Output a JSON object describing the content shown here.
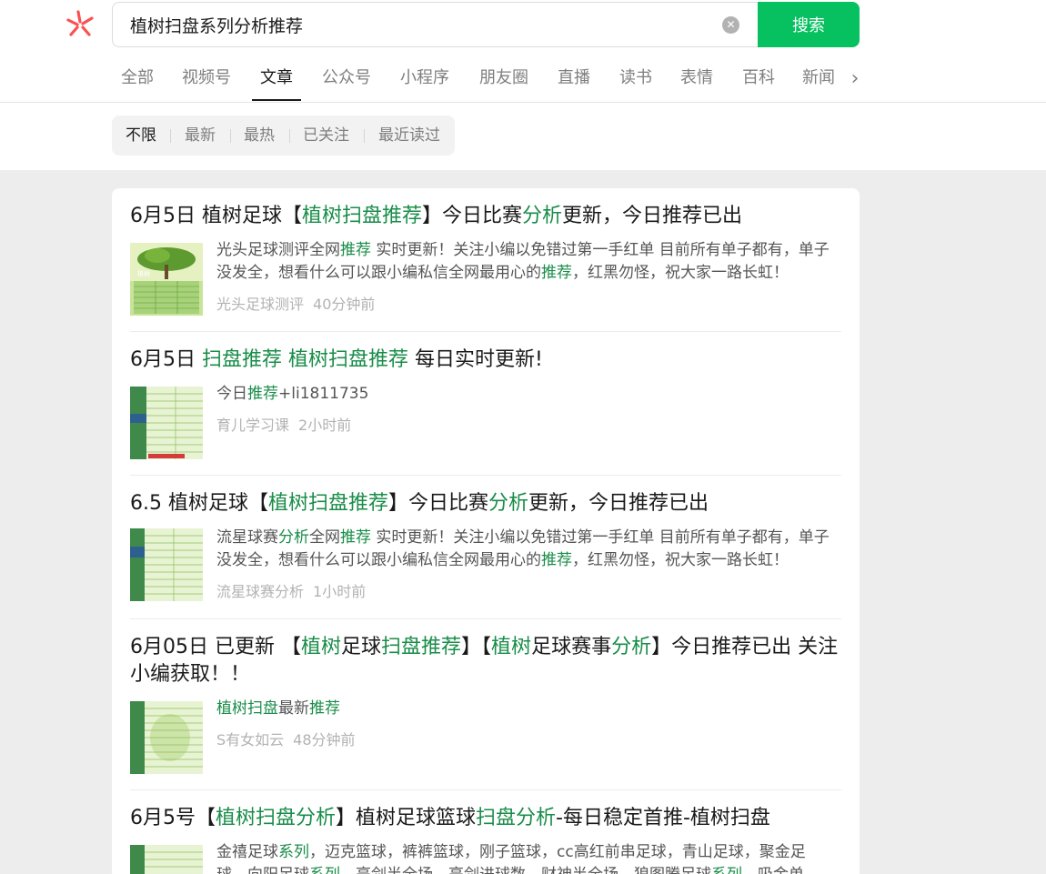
{
  "search": {
    "query": "植树扫盘系列分析推荐",
    "button_label": "搜索",
    "clear_icon": "clear-icon"
  },
  "tabs": [
    {
      "label": "全部"
    },
    {
      "label": "视频号"
    },
    {
      "label": "文章",
      "active": true
    },
    {
      "label": "公众号"
    },
    {
      "label": "小程序"
    },
    {
      "label": "朋友圈"
    },
    {
      "label": "直播"
    },
    {
      "label": "读书"
    },
    {
      "label": "表情"
    },
    {
      "label": "百科"
    },
    {
      "label": "新闻"
    }
  ],
  "filters": [
    {
      "label": "不限",
      "active": true
    },
    {
      "label": "最新"
    },
    {
      "label": "最热"
    },
    {
      "label": "已关注"
    },
    {
      "label": "最近读过"
    }
  ],
  "colors": {
    "accent": "#07c160",
    "highlight": "#198d49"
  },
  "results": [
    {
      "title": [
        {
          "t": "6月5日 植树足球【"
        },
        {
          "t": "植树扫盘推荐",
          "hl": true
        },
        {
          "t": "】今日比赛"
        },
        {
          "t": "分析",
          "hl": true
        },
        {
          "t": "更新，今日推荐已出"
        }
      ],
      "desc": [
        {
          "t": "光头足球测评全网"
        },
        {
          "t": "推荐",
          "hl": true
        },
        {
          "t": " 实时更新！关注小编以免错过第一手红单 目前所有单子都有，单子没发全，想看什么可以跟小编私信全网最用心的"
        },
        {
          "t": "推荐",
          "hl": true
        },
        {
          "t": "，红黑勿怪，祝大家一路长虹！"
        }
      ],
      "source": "光头足球测评",
      "time": "40分钟前"
    },
    {
      "title": [
        {
          "t": "6月5日 "
        },
        {
          "t": "扫盘推荐",
          "hl": true
        },
        {
          "t": " "
        },
        {
          "t": "植树扫盘推荐",
          "hl": true
        },
        {
          "t": " 每日实时更新!"
        }
      ],
      "desc": [
        {
          "t": "今日"
        },
        {
          "t": "推荐",
          "hl": true
        },
        {
          "t": "+li1811735"
        }
      ],
      "source": "育儿学习课",
      "time": "2小时前"
    },
    {
      "title": [
        {
          "t": "6.5 植树足球【"
        },
        {
          "t": "植树扫盘推荐",
          "hl": true
        },
        {
          "t": "】今日比赛"
        },
        {
          "t": "分析",
          "hl": true
        },
        {
          "t": "更新，今日推荐已出"
        }
      ],
      "desc": [
        {
          "t": "流星球赛"
        },
        {
          "t": "分析",
          "hl": true
        },
        {
          "t": "全网"
        },
        {
          "t": "推荐",
          "hl": true
        },
        {
          "t": " 实时更新！关注小编以免错过第一手红单 目前所有单子都有，单子没发全，想看什么可以跟小编私信全网最用心的"
        },
        {
          "t": "推荐",
          "hl": true
        },
        {
          "t": "，红黑勿怪，祝大家一路长虹！"
        }
      ],
      "source": "流星球赛分析",
      "time": "1小时前"
    },
    {
      "title": [
        {
          "t": "6月05日 已更新 【"
        },
        {
          "t": "植树",
          "hl": true
        },
        {
          "t": "足球"
        },
        {
          "t": "扫盘推荐",
          "hl": true
        },
        {
          "t": "】【"
        },
        {
          "t": "植树",
          "hl": true
        },
        {
          "t": "足球赛事"
        },
        {
          "t": "分析",
          "hl": true
        },
        {
          "t": "】今日推荐已出 关注小编获取！！"
        }
      ],
      "desc": [
        {
          "t": "植树扫盘",
          "hl": true
        },
        {
          "t": "最新"
        },
        {
          "t": "推荐",
          "hl": true
        }
      ],
      "source": "S有女如云",
      "time": "48分钟前"
    },
    {
      "title": [
        {
          "t": "6月5号【"
        },
        {
          "t": "植树扫盘分析",
          "hl": true
        },
        {
          "t": "】植树足球篮球"
        },
        {
          "t": "扫盘分析",
          "hl": true
        },
        {
          "t": "-每日稳定首推-植树扫盘"
        }
      ],
      "desc": [
        {
          "t": "金禧足球"
        },
        {
          "t": "系列",
          "hl": true
        },
        {
          "t": "，迈克篮球，裤裤篮球，刚子篮球，cc高红前串足球，青山足球，聚金足球，向阳足球"
        },
        {
          "t": "系列",
          "hl": true
        },
        {
          "t": "，亮剑半全场，亮剑进球数，财神半全场，狼图腾足球"
        },
        {
          "t": "系列",
          "hl": true
        },
        {
          "t": "，吸金单"
        }
      ],
      "source": "",
      "time": ""
    }
  ]
}
